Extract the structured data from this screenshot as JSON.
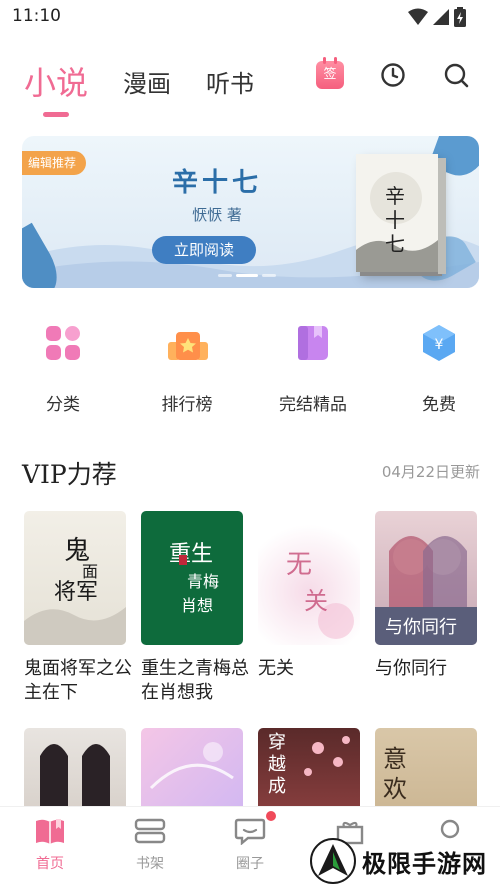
{
  "status_bar": {
    "time": "11:10"
  },
  "top_tabs": {
    "tabs": [
      {
        "label": "小说",
        "active": true
      },
      {
        "label": "漫画",
        "active": false
      },
      {
        "label": "听书",
        "active": false
      }
    ],
    "signin_label": "签",
    "icons": [
      "signin-icon",
      "history-icon",
      "search-icon"
    ]
  },
  "banner": {
    "tag": "编辑推荐",
    "title": "辛十七",
    "author": "恹恹 著",
    "button": "立即阅读",
    "book_cover_text": "辛十七",
    "page_count": 3,
    "active_page": 2
  },
  "categories": [
    {
      "label": "分类",
      "icon": "grid-icon"
    },
    {
      "label": "排行榜",
      "icon": "ranking-icon"
    },
    {
      "label": "完结精品",
      "icon": "bookmark-book-icon"
    },
    {
      "label": "免费",
      "icon": "free-coin-icon"
    }
  ],
  "vip_section": {
    "title": "VIP力荐",
    "date": "04月22日更新",
    "books": [
      {
        "title": "鬼面将军之公主在下",
        "cover_text": "鬼面将军"
      },
      {
        "title": "重生之青梅总在肖想我",
        "cover_text": "重生之青梅总在肖想我"
      },
      {
        "title": "无关",
        "cover_text": "无关"
      },
      {
        "title": "与你同行",
        "cover_text": "与你同行"
      }
    ],
    "more_books": [
      {
        "cover_text": ""
      },
      {
        "cover_text": ""
      },
      {
        "cover_text": "穿越成"
      },
      {
        "cover_text": "意欢"
      }
    ]
  },
  "bottom_nav": [
    {
      "label": "首页",
      "icon": "home-book-icon",
      "active": true
    },
    {
      "label": "书架",
      "icon": "bookshelf-icon",
      "active": false
    },
    {
      "label": "圈子",
      "icon": "chat-bubble-icon",
      "active": false,
      "badge": true
    },
    {
      "label": "",
      "icon": "gift-icon",
      "active": false
    },
    {
      "label": "",
      "icon": "profile-icon",
      "active": false
    }
  ],
  "watermark": {
    "text": "极限手游网"
  },
  "colors": {
    "accent": "#f06b93",
    "banner_blue": "#2b6ea8",
    "tag_orange": "#f3a34a"
  }
}
